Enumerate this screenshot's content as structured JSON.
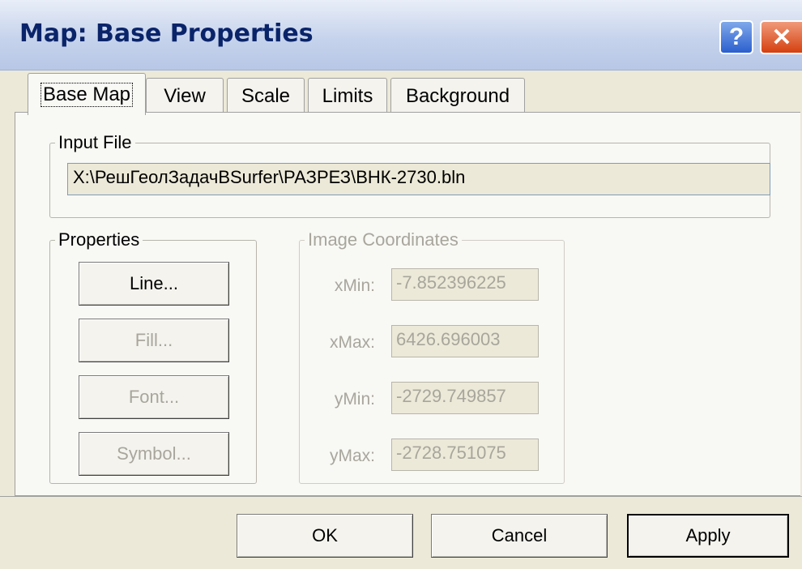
{
  "window": {
    "title": "Map: Base Properties",
    "help_glyph": "?",
    "close_glyph": "✕"
  },
  "tabs": [
    {
      "label": "Base Map",
      "active": true
    },
    {
      "label": "View"
    },
    {
      "label": "Scale"
    },
    {
      "label": "Limits"
    },
    {
      "label": "Background"
    }
  ],
  "input_file": {
    "legend": "Input File",
    "value": "X:\\РешГеолЗадачBSurfer\\РАЗРЕЗ\\ВНК-2730.bln"
  },
  "properties": {
    "legend": "Properties",
    "buttons": {
      "line": "Line...",
      "fill": "Fill...",
      "font": "Font...",
      "symbol": "Symbol..."
    }
  },
  "image_coordinates": {
    "legend": "Image Coordinates",
    "xmin_label": "xMin:",
    "xmin_value": "-7.852396225",
    "xmax_label": "xMax:",
    "xmax_value": "6426.696003",
    "ymin_label": "yMin:",
    "ymin_value": "-2729.749857",
    "ymax_label": "yMax:",
    "ymax_value": "-2728.751075"
  },
  "footer": {
    "ok": "OK",
    "cancel": "Cancel",
    "apply": "Apply"
  }
}
